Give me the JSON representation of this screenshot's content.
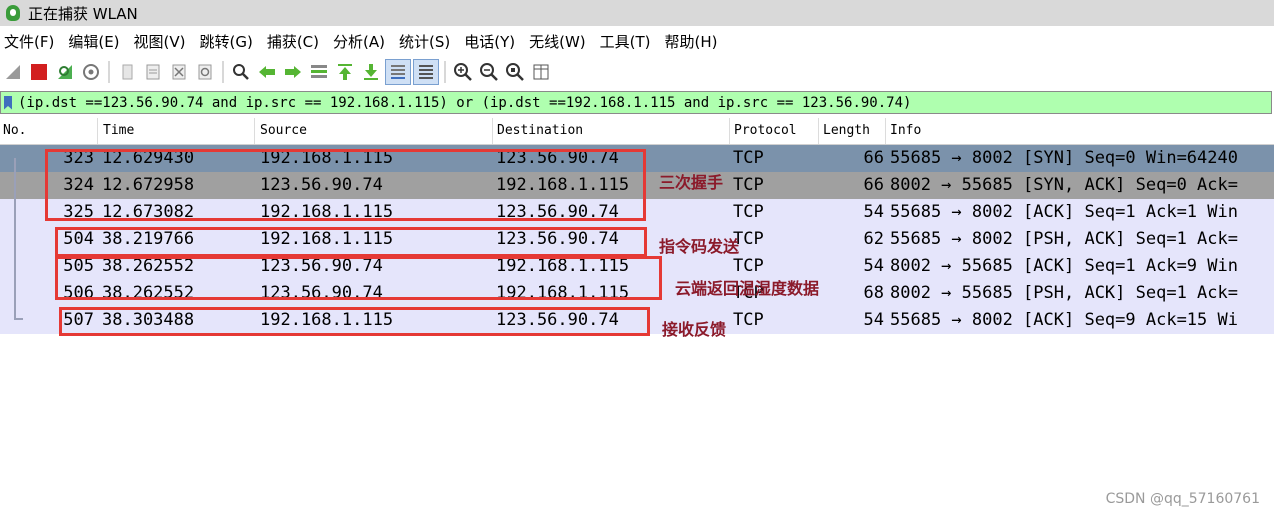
{
  "window": {
    "title": "正在捕获 WLAN"
  },
  "menu": [
    "文件(F)",
    "编辑(E)",
    "视图(V)",
    "跳转(G)",
    "捕获(C)",
    "分析(A)",
    "统计(S)",
    "电话(Y)",
    "无线(W)",
    "工具(T)",
    "帮助(H)"
  ],
  "toolbar": {
    "icons": [
      "shark-fin-start-icon",
      "stop-capture-icon",
      "restart-capture-icon",
      "capture-options-icon",
      "open-file-icon",
      "save-file-icon",
      "close-file-icon",
      "reload-file-icon",
      "find-packet-icon",
      "go-back-icon",
      "go-forward-icon",
      "go-to-packet-icon",
      "go-first-icon",
      "go-last-icon",
      "autoscroll-icon",
      "colorize-icon",
      "zoom-in-icon",
      "zoom-out-icon",
      "zoom-normal-icon",
      "resize-columns-icon"
    ]
  },
  "filter": {
    "expression": "(ip.dst ==123.56.90.74 and ip.src == 192.168.1.115) or (ip.dst ==192.168.1.115 and ip.src == 123.56.90.74)"
  },
  "columns": {
    "no": "No.",
    "time": "Time",
    "source": "Source",
    "destination": "Destination",
    "protocol": "Protocol",
    "length": "Length",
    "info": "Info"
  },
  "packets": [
    {
      "no": "323",
      "time": "12.629430",
      "source": "192.168.1.115",
      "destination": "123.56.90.74",
      "protocol": "TCP",
      "length": "66",
      "info": "55685 → 8002 [SYN] Seq=0 Win=64240"
    },
    {
      "no": "324",
      "time": "12.672958",
      "source": "123.56.90.74",
      "destination": "192.168.1.115",
      "protocol": "TCP",
      "length": "66",
      "info": "8002 → 55685 [SYN, ACK] Seq=0 Ack="
    },
    {
      "no": "325",
      "time": "12.673082",
      "source": "192.168.1.115",
      "destination": "123.56.90.74",
      "protocol": "TCP",
      "length": "54",
      "info": "55685 → 8002 [ACK] Seq=1 Ack=1 Win"
    },
    {
      "no": "504",
      "time": "38.219766",
      "source": "192.168.1.115",
      "destination": "123.56.90.74",
      "protocol": "TCP",
      "length": "62",
      "info": "55685 → 8002 [PSH, ACK] Seq=1 Ack="
    },
    {
      "no": "505",
      "time": "38.262552",
      "source": "123.56.90.74",
      "destination": "192.168.1.115",
      "protocol": "TCP",
      "length": "54",
      "info": "8002 → 55685 [ACK] Seq=1 Ack=9 Win"
    },
    {
      "no": "506",
      "time": "38.262552",
      "source": "123.56.90.74",
      "destination": "192.168.1.115",
      "protocol": "TCP",
      "length": "68",
      "info": "8002 → 55685 [PSH, ACK] Seq=1 Ack="
    },
    {
      "no": "507",
      "time": "38.303488",
      "source": "192.168.1.115",
      "destination": "123.56.90.74",
      "protocol": "TCP",
      "length": "54",
      "info": "55685 → 8002 [ACK] Seq=9 Ack=15 Wi"
    }
  ],
  "annotations": {
    "handshake": "三次握手",
    "command_send": "指令码发送",
    "cloud_return": "云端返回温湿度数据",
    "receive_feedback": "接收反馈"
  },
  "watermark": "CSDN @qq_57160761",
  "colors": {
    "filter_bg": "#afffaf",
    "row_bg": "#e5e5fb",
    "selected_row": "#7b92ab",
    "annotation_box": "#e53935",
    "annotation_text": "#8b1a2a"
  }
}
